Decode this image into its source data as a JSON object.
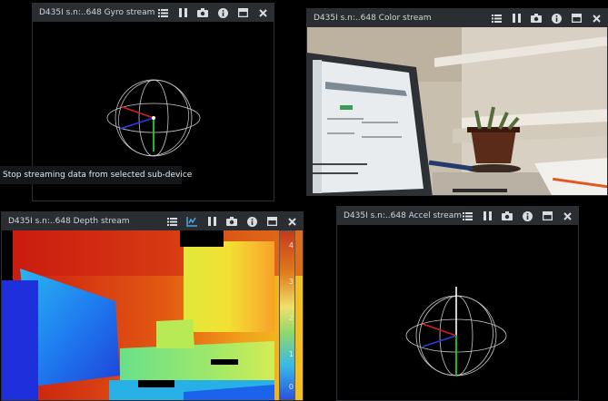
{
  "windows": {
    "gyro": {
      "title": "D435I s.n:..648 Gyro stream"
    },
    "color": {
      "title": "D435I s.n:..648 Color stream"
    },
    "depth": {
      "title": "D435I s.n:..648 Depth stream"
    },
    "accel": {
      "title": "D435I s.n:..648 Accel stream"
    }
  },
  "tooltip": {
    "text": "Stop streaming data from selected sub-device"
  },
  "depth_scale": {
    "labels": [
      "4",
      "3",
      "2",
      "1",
      "0"
    ]
  },
  "colors": {
    "titlebar": "#2a2e32",
    "accent": "#4aa3df",
    "axis_x": "#d11f1f",
    "axis_y": "#1fd11f",
    "axis_z": "#2a3de0"
  },
  "icons": [
    "info-list-icon",
    "metrics-icon",
    "pause-icon",
    "camera-icon",
    "info-icon",
    "window-icon",
    "close-icon"
  ]
}
